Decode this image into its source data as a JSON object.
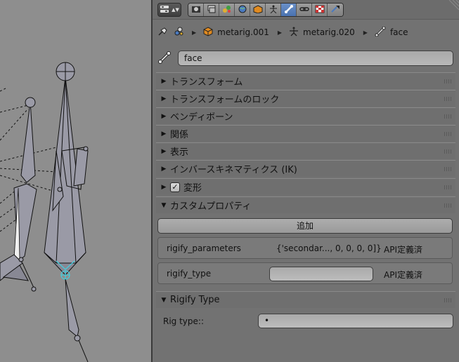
{
  "viewport": {
    "background": "#8e8e8e",
    "highlight_color": "#40d0e0"
  },
  "header": {
    "editor_type_icon": "properties-editor-icon",
    "contexts": [
      {
        "name": "render-icon",
        "active": false
      },
      {
        "name": "render-layers-icon",
        "active": false
      },
      {
        "name": "scene-icon",
        "active": false
      },
      {
        "name": "world-icon",
        "active": false
      },
      {
        "name": "object-icon",
        "active": false
      },
      {
        "name": "armature-data-icon",
        "active": false
      },
      {
        "name": "bone-icon",
        "active": true
      },
      {
        "name": "constraints-icon",
        "active": false
      },
      {
        "name": "texture-icon",
        "active": false
      },
      {
        "name": "modifier-icon",
        "active": false
      }
    ],
    "accent_color": "#5680c0"
  },
  "breadcrumb": {
    "object": "metarig.001",
    "armature": "metarig.020",
    "bone": "face"
  },
  "bone_name": "face",
  "sections": {
    "transform": "トランスフォーム",
    "transform_lock": "トランスフォームのロック",
    "bendy_bones": "ベンディボーン",
    "relations": "関係",
    "display": "表示",
    "ik": "インバースキネマティクス (IK)",
    "deform": "変形",
    "custom_props": "カスタムプロパティ",
    "rigify_type": "Rigify Type"
  },
  "deform_checked": true,
  "custom_props": {
    "add_label": "追加",
    "items": [
      {
        "name": "rigify_parameters",
        "value": "{'secondar..., 0, 0, 0, 0]}",
        "api": "API定義済"
      },
      {
        "name": "rigify_type",
        "value": "",
        "api": "API定義済"
      }
    ]
  },
  "rigify": {
    "label": "Rig type::",
    "value": "•"
  }
}
